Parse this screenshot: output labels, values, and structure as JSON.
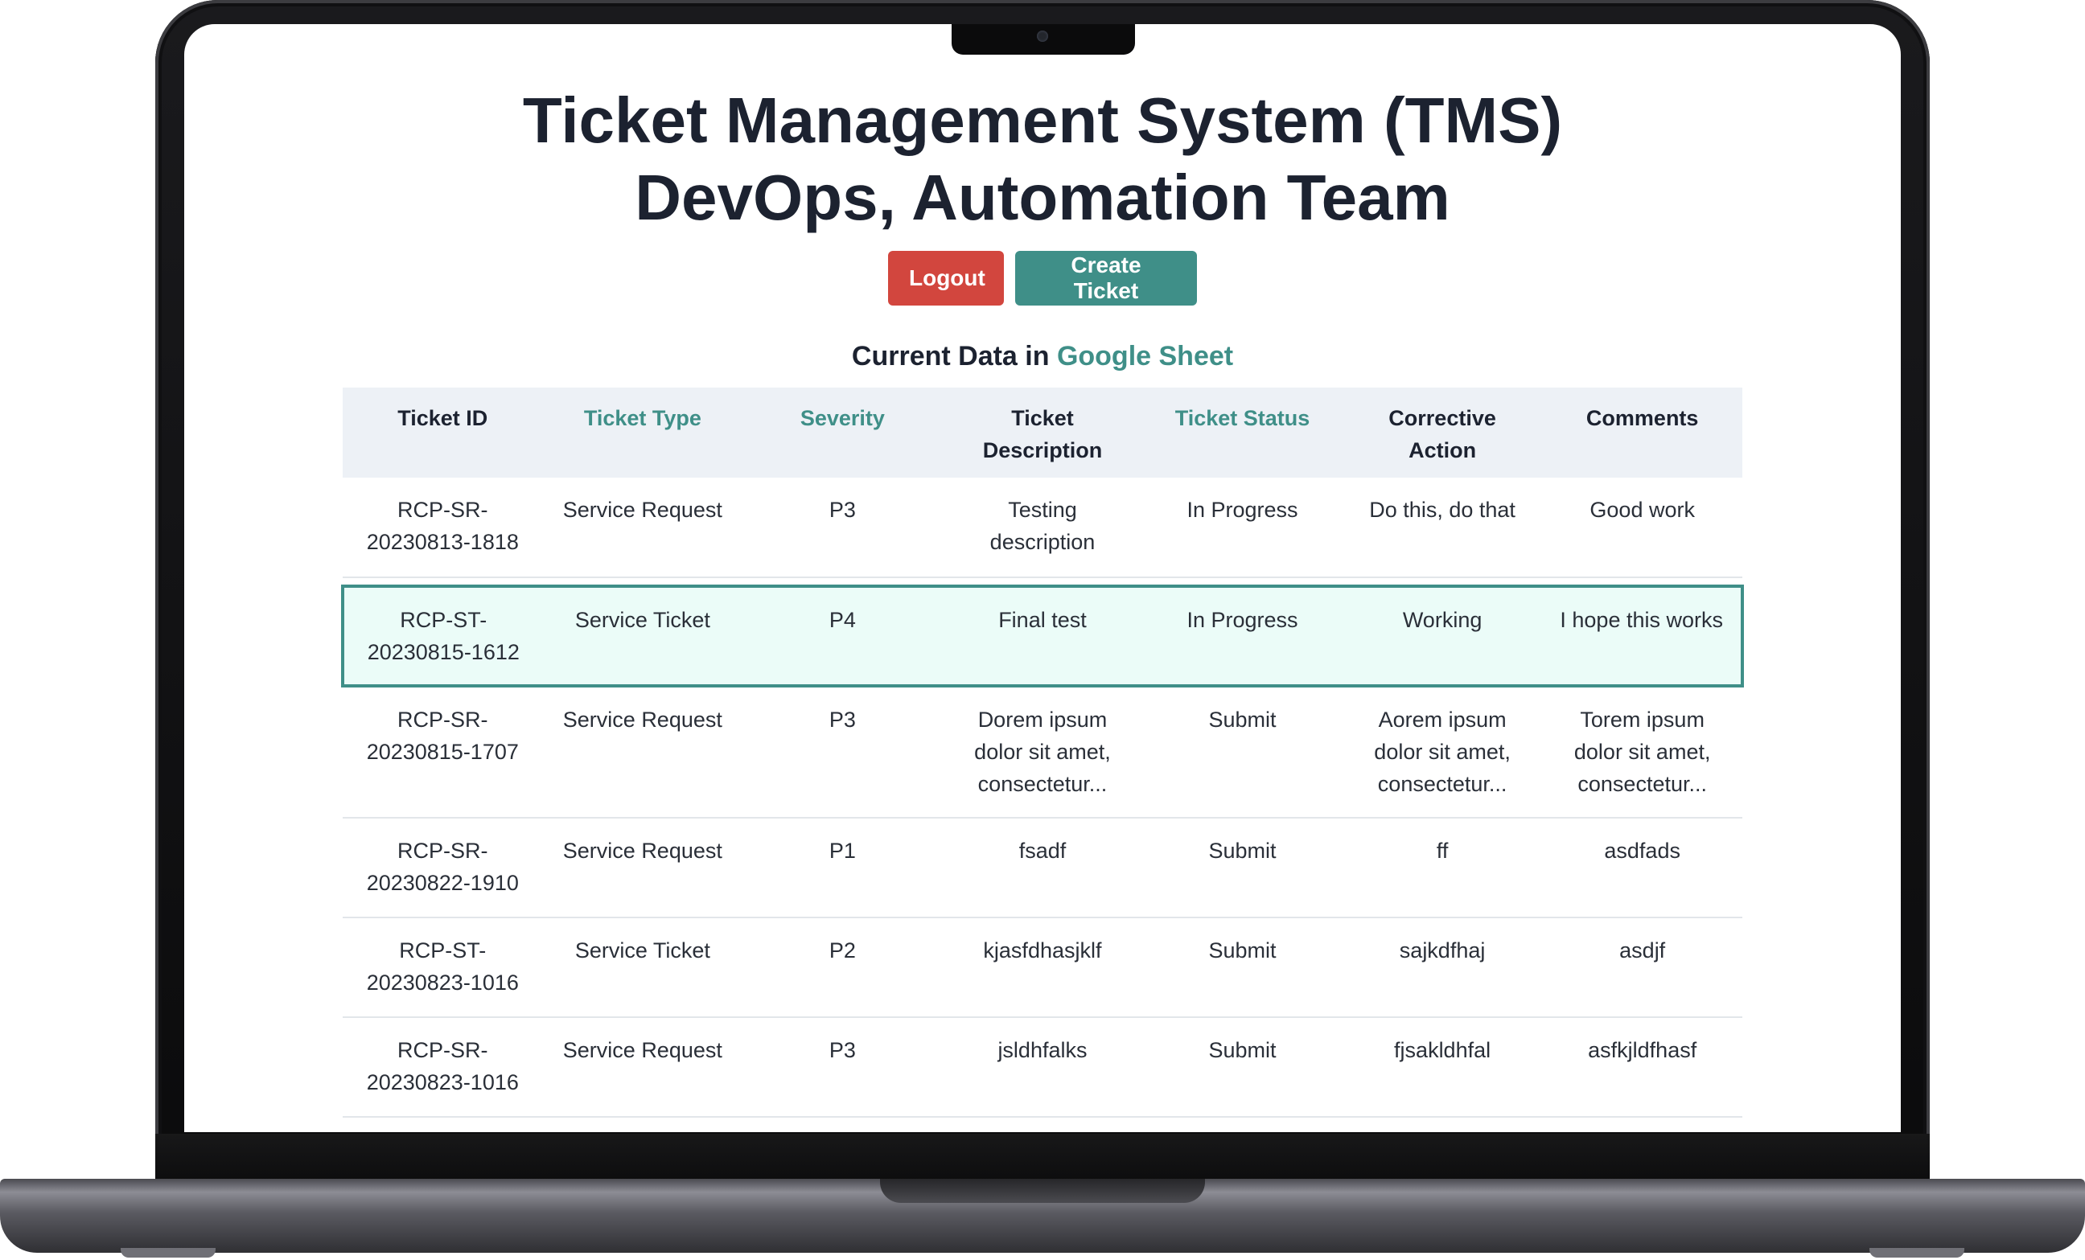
{
  "header": {
    "title_line1": "Ticket Management System (TMS)",
    "title_line2": "DevOps, Automation Team"
  },
  "actions": {
    "logout_label": "Logout",
    "create_label": "Create Ticket"
  },
  "data_caption": {
    "prefix": "Current Data in ",
    "link_text": "Google Sheet"
  },
  "table": {
    "columns": [
      "Ticket ID",
      "Ticket Type",
      "Severity",
      "Ticket Description",
      "Ticket Status",
      "Corrective Action",
      "Comments"
    ],
    "rows": [
      [
        "RCP-SR-20230813-1818",
        "Service Request",
        "P3",
        "Testing description",
        "In Progress",
        "Do this, do that",
        "Good work"
      ],
      [
        "RCP-ST-20230815-1612",
        "Service Ticket",
        "P4",
        "Final test",
        "In Progress",
        "Working",
        "I hope this works"
      ],
      [
        "RCP-SR-20230815-1707",
        "Service Request",
        "P3",
        "Dorem ipsum dolor sit amet, consectetur...",
        "Submit",
        "Aorem ipsum dolor sit amet, consectetur...",
        "Torem ipsum dolor sit amet, consectetur..."
      ],
      [
        "RCP-SR-20230822-1910",
        "Service Request",
        "P1",
        "fsadf",
        "Submit",
        "ff",
        "asdfads"
      ],
      [
        "RCP-ST-20230823-1016",
        "Service Ticket",
        "P2",
        "kjasfdhasjklf",
        "Submit",
        "sajkdfhaj",
        "asdjf"
      ],
      [
        "RCP-SR-20230823-1016",
        "Service Request",
        "P3",
        "jsldhfalks",
        "Submit",
        "fjsakldhfal",
        "asfkjldfhasf"
      ]
    ]
  },
  "colors": {
    "accent": "#3f8f88",
    "logout": "#d2463e",
    "header_bg": "#edf1f6",
    "selected_row_bg": "#ebfcf8"
  }
}
